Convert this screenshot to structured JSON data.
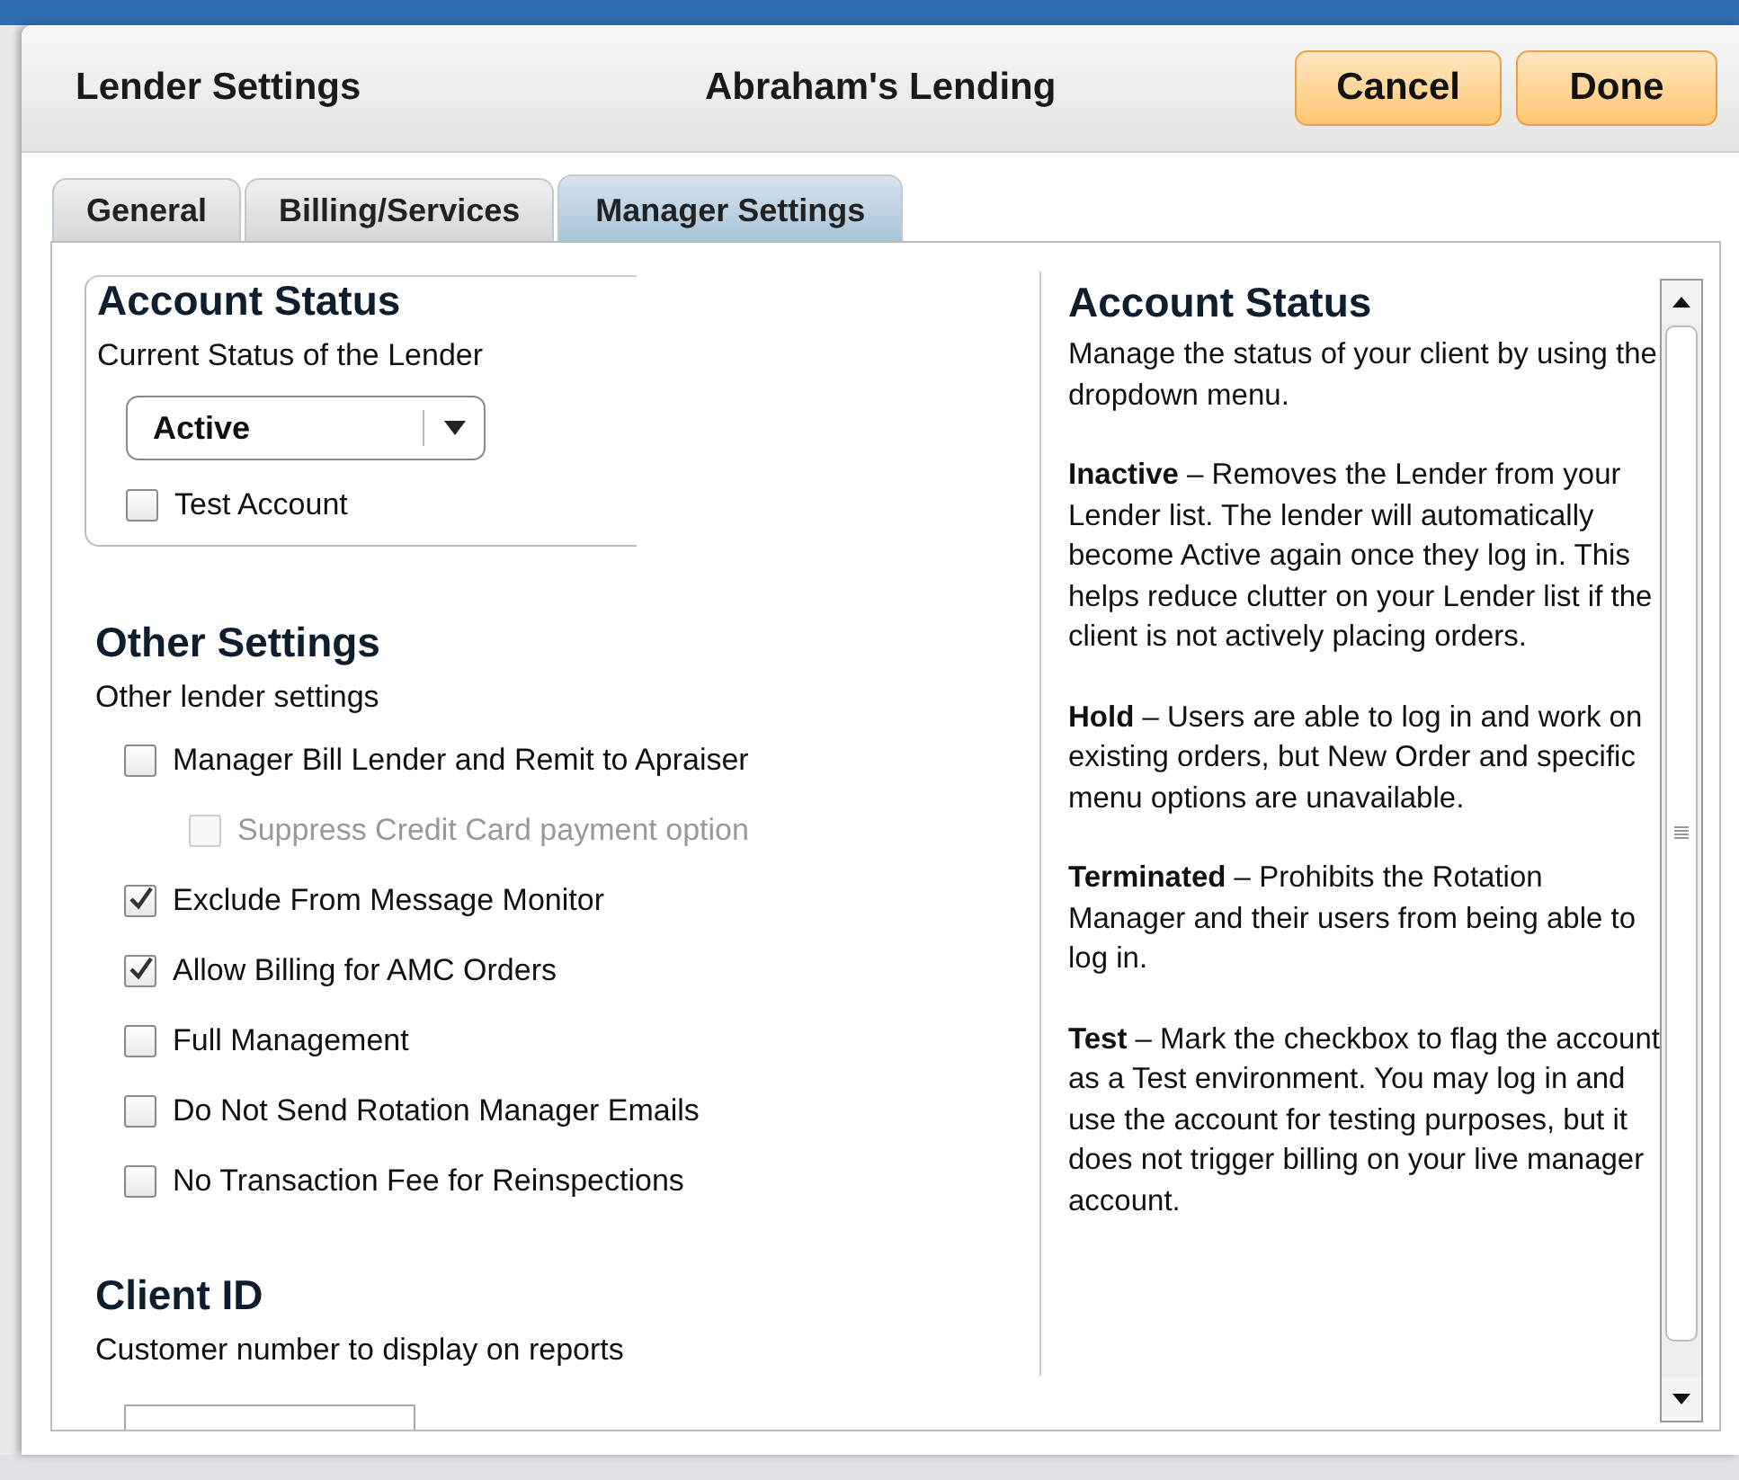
{
  "header": {
    "title": "Lender Settings",
    "client": "Abraham's Lending",
    "buttons": [
      {
        "label": "Cancel"
      },
      {
        "label": "Done"
      }
    ]
  },
  "tabs": [
    {
      "label": "General",
      "selected": false
    },
    {
      "label": "Billing/Services",
      "selected": false
    },
    {
      "label": "Manager Settings",
      "selected": true
    }
  ],
  "account_status": {
    "heading": "Account Status",
    "subtitle": "Current Status of the Lender",
    "status_select": {
      "value": "Active"
    },
    "test_account": {
      "label": "Test Account",
      "checked": false,
      "disabled": false
    }
  },
  "other_settings": {
    "heading": "Other Settings",
    "subtitle": "Other lender settings",
    "options": [
      {
        "label": "Manager Bill Lender and Remit to Apraiser",
        "checked": false,
        "disabled": false,
        "children": [
          {
            "label": "Suppress Credit Card payment option",
            "checked": false,
            "disabled": true
          }
        ]
      },
      {
        "label": "Exclude From Message Monitor",
        "checked": true,
        "disabled": false
      },
      {
        "label": "Allow Billing for AMC Orders",
        "checked": true,
        "disabled": false
      },
      {
        "label": "Full Management",
        "checked": false,
        "disabled": false
      },
      {
        "label": "Do Not Send Rotation Manager Emails",
        "checked": false,
        "disabled": false
      },
      {
        "label": "No Transaction Fee for Reinspections",
        "checked": false,
        "disabled": false
      }
    ]
  },
  "client_id": {
    "heading": "Client ID",
    "subtitle": "Customer number to display on reports"
  },
  "help": {
    "heading": "Account Status",
    "paragraphs": [
      "Manage the status of your client by using the dropdown menu.",
      "**Inactive** – Removes the Lender from your Lender list. The lender will automatically become Active again once they log in. This helps reduce clutter on your Lender list if the client is not actively placing orders.",
      "**Hold** – Users are able to log in and work on existing orders, but New Order and specific menu options are unavailable.",
      "**Terminated** – Prohibits the Rotation Manager and their users from being able to log in.",
      "**Test** – Mark the checkbox to flag the account as a Test environment. You may log in and use the account for testing purposes, but it does not trigger billing on your live manager account."
    ]
  }
}
